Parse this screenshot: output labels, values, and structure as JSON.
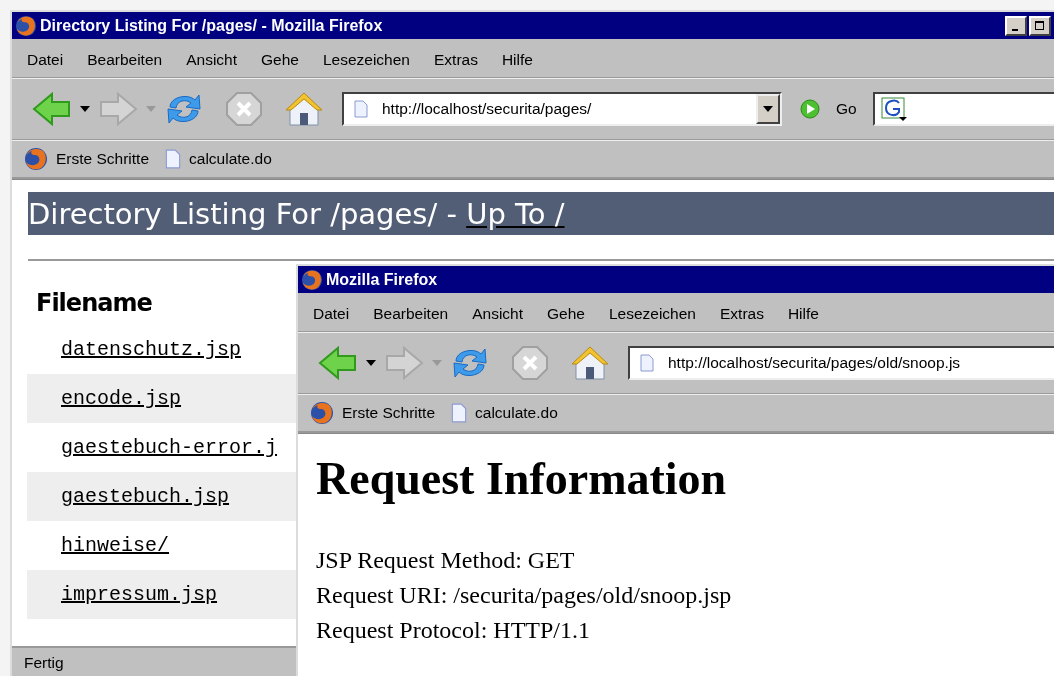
{
  "windows": [
    {
      "kind": "listing",
      "title": "Directory Listing For /pages/ - Mozilla Firefox",
      "title_buttons": true,
      "menu": [
        "Datei",
        "Bearbeiten",
        "Ansicht",
        "Gehe",
        "Lesezeichen",
        "Extras",
        "Hilfe"
      ],
      "url": "http://localhost/securita/pages/",
      "go_label": "Go",
      "bookmarks": [
        "Erste Schritte",
        "calculate.do"
      ],
      "heading": "Directory Listing For /pages/ - ",
      "heading_link": "Up To /",
      "column": "Filename",
      "files": [
        {
          "name": "datenschutz.jsp",
          "shaded": false
        },
        {
          "name": "encode.jsp",
          "shaded": true
        },
        {
          "name": "gaestebuch-error.j",
          "shaded": false
        },
        {
          "name": "gaestebuch.jsp",
          "shaded": true
        },
        {
          "name": "hinweise/",
          "shaded": false
        },
        {
          "name": "impressum.jsp",
          "shaded": true
        }
      ],
      "status": "Fertig"
    },
    {
      "kind": "snoop",
      "title": "Mozilla Firefox",
      "title_buttons": false,
      "menu": [
        "Datei",
        "Bearbeiten",
        "Ansicht",
        "Gehe",
        "Lesezeichen",
        "Extras",
        "Hilfe"
      ],
      "url": "http://localhost/securita/pages/old/snoop.js",
      "bookmarks": [
        "Erste Schritte",
        "calculate.do"
      ],
      "heading": "Request Information",
      "lines": [
        "JSP Request Method: GET",
        "Request URI: /securita/pages/old/snoop.jsp",
        "Request Protocol: HTTP/1.1"
      ]
    }
  ]
}
